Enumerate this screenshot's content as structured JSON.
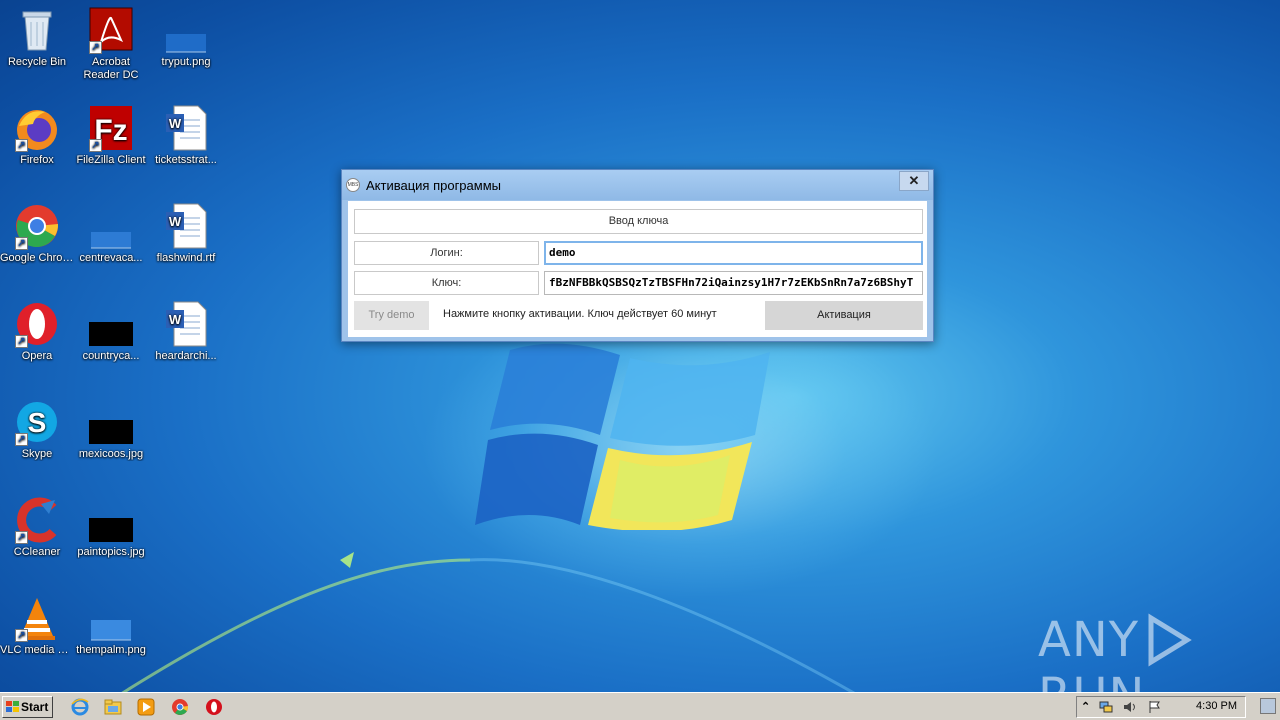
{
  "desktop": {
    "icons": [
      {
        "label": "Recycle Bin",
        "icon": "recycle-bin-icon"
      },
      {
        "label": "Acrobat Reader DC",
        "icon": "acrobat-icon"
      },
      {
        "label": "tryput.png",
        "icon": "image-file-icon"
      },
      {
        "label": "Firefox",
        "icon": "firefox-icon"
      },
      {
        "label": "FileZilla Client",
        "icon": "filezilla-icon"
      },
      {
        "label": "ticketsstrat...",
        "icon": "word-doc-icon"
      },
      {
        "label": "Google Chrome",
        "icon": "chrome-icon"
      },
      {
        "label": "centrevaca...",
        "icon": "image-file-icon"
      },
      {
        "label": "flashwind.rtf",
        "icon": "word-doc-icon"
      },
      {
        "label": "Opera",
        "icon": "opera-icon"
      },
      {
        "label": "countryca...",
        "icon": "image-file-icon"
      },
      {
        "label": "heardarchi...",
        "icon": "word-doc-icon"
      },
      {
        "label": "Skype",
        "icon": "skype-icon"
      },
      {
        "label": "mexicoos.jpg",
        "icon": "image-file-icon"
      },
      {
        "label": "CCleaner",
        "icon": "ccleaner-icon"
      },
      {
        "label": "paintopics.jpg",
        "icon": "image-file-icon"
      },
      {
        "label": "VLC media player",
        "icon": "vlc-icon"
      },
      {
        "label": "thempalm.png",
        "icon": "image-file-icon"
      }
    ]
  },
  "dialog": {
    "title": "Активация программы",
    "title_icon_text": "MBS",
    "close_glyph": "✕",
    "header": "Ввод ключа",
    "login_label": "Логин:",
    "login_value": "demo",
    "key_label": "Ключ:",
    "key_value": "fBzNFBBkQSBSQzTzTBSFHn72iQainzsy1H7r7zEKbSnRn7a7z6BShyT",
    "try_demo": "Try demo",
    "hint": "Нажмите кнопку активации. Ключ действует 60 минут",
    "activate": "Активация"
  },
  "watermark": {
    "left": "ANY",
    "right": "RUN"
  },
  "taskbar": {
    "start": "Start",
    "pinned": [
      "ie-icon",
      "explorer-icon",
      "media-player-icon",
      "chrome-icon",
      "opera-icon"
    ],
    "time": "4:30 PM"
  }
}
